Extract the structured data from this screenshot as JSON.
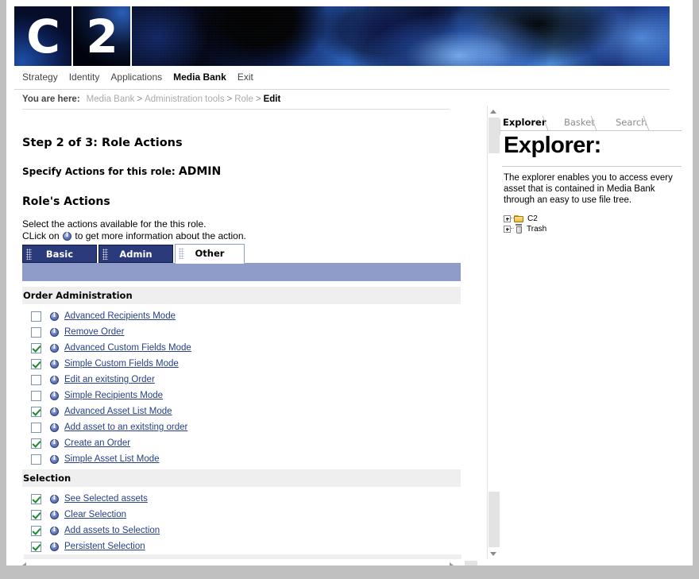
{
  "window": {
    "logo": {
      "left_letter": "C",
      "right_letter": "2",
      "alt": "C2 logo"
    }
  },
  "mainnav": {
    "items": [
      {
        "label": "Strategy",
        "active": false
      },
      {
        "label": "Identity",
        "active": false
      },
      {
        "label": "Applications",
        "active": false
      },
      {
        "label": "Media Bank",
        "active": true
      },
      {
        "label": "Exit",
        "active": false
      }
    ]
  },
  "breadcrumb": {
    "label": "You are here:",
    "items": [
      "Media Bank",
      "Administration tools",
      "Role",
      "Edit"
    ],
    "separator": ">",
    "current": "Edit"
  },
  "content": {
    "step_title": "Step 2 of 3: Role Actions",
    "specify_prefix": "Specify Actions for this role:",
    "role_name": "ADMIN",
    "section_title": "Role's Actions",
    "help_line1": "Select the actions available for the this role.",
    "help_line2_pre": "CLick on",
    "help_line2_post": "to get more information about the action."
  },
  "tabs": [
    {
      "label": "Basic",
      "active": false
    },
    {
      "label": "Admin",
      "active": false
    },
    {
      "label": "Other",
      "active": true
    }
  ],
  "groups": [
    {
      "title": "Order Administration",
      "options": [
        {
          "label": "Advanced Recipients Mode",
          "checked": false
        },
        {
          "label": "Remove Order",
          "checked": false
        },
        {
          "label": "Advanced Custom Fields Mode",
          "checked": true
        },
        {
          "label": "Simple Custom Fields Mode",
          "checked": true
        },
        {
          "label": "Edit an exitsting Order",
          "checked": false
        },
        {
          "label": "Simple Recipients Mode",
          "checked": false
        },
        {
          "label": "Advanced Asset List Mode",
          "checked": true
        },
        {
          "label": "Add asset to an exitsting order",
          "checked": false
        },
        {
          "label": "Create an Order",
          "checked": true
        },
        {
          "label": "Simple Asset List Mode",
          "checked": false
        }
      ]
    },
    {
      "title": "Selection",
      "options": [
        {
          "label": "See Selected assets",
          "checked": true
        },
        {
          "label": "Clear Selection",
          "checked": true
        },
        {
          "label": "Add assets to Selection",
          "checked": true
        },
        {
          "label": "Persistent Selection",
          "checked": true
        }
      ]
    }
  ],
  "explorer": {
    "tabs": [
      {
        "label": "Explorer",
        "active": true
      },
      {
        "label": "Basket",
        "active": false
      },
      {
        "label": "Search",
        "active": false
      }
    ],
    "title": "Explorer:",
    "description": "The explorer enables you to access every asset that is contained in Media Bank through an easy to use file tree.",
    "tree": [
      {
        "label": "C2",
        "icon": "folder-icon",
        "expander": "plus"
      },
      {
        "label": "Trash",
        "icon": "trash-icon",
        "expander": "plus"
      }
    ]
  },
  "colors": {
    "tab_inactive_bg": "#2b3a7a",
    "tab_strip_bg": "#8f9bc8",
    "group_header_bg": "#efefef",
    "link": "#26408a",
    "check_green": "#1a8a2a",
    "window_chrome": "#c0c0c0"
  }
}
